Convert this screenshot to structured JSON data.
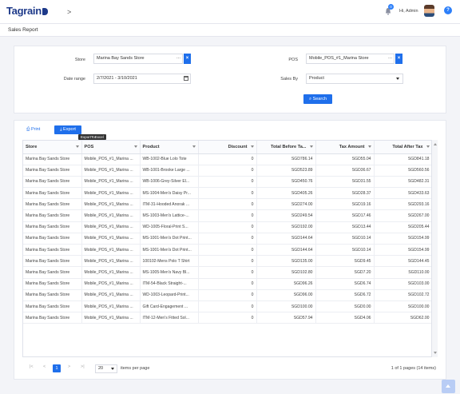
{
  "app": {
    "logo": "Tagrain",
    "greeting": "Hi, Admin",
    "notification_count": "0",
    "help": "?"
  },
  "page": {
    "title": "Sales Report"
  },
  "filters": {
    "store_label": "Store",
    "store_value": "Marina Bay Sands Store",
    "pos_label": "POS",
    "pos_value": "Mobile_POS_#1_Marina Store",
    "date_label": "Date range",
    "date_value": "2/7/2021 - 3/10/2021",
    "salesby_label": "Sales By",
    "salesby_value": "Product",
    "search_label": "Search",
    "dots": "..."
  },
  "toolbar": {
    "print_label": "Print",
    "export_label": "Export",
    "tooltip": "ExportToExcel"
  },
  "table": {
    "columns": [
      "Store",
      "POS",
      "Product",
      "Discount",
      "Total Before Ta...",
      "Tax Amount",
      "Total After Tax"
    ],
    "rows": [
      [
        "Marina Bay Sands Store",
        "Mobile_POS_#1_Marina ...",
        "WB-1002-Blue Lolo Tote",
        "0",
        "SGD786.14",
        "SGD55.04",
        "SGD841.18"
      ],
      [
        "Marina Bay Sands Store",
        "Mobile_POS_#1_Marina ...",
        "WB-1001-Brooke Large ...",
        "0",
        "SGD523.89",
        "SGD36.67",
        "SGD560.56"
      ],
      [
        "Marina Bay Sands Store",
        "Mobile_POS_#1_Marina ...",
        "WB-1006-Grey-Silver El...",
        "0",
        "SGD450.76",
        "SGD31.55",
        "SGD482.31"
      ],
      [
        "Marina Bay Sands Store",
        "Mobile_POS_#1_Marina ...",
        "MS-1004-Men's Daisy Pr...",
        "0",
        "SGD405.26",
        "SGD28.37",
        "SGD433.63"
      ],
      [
        "Marina Bay Sands Store",
        "Mobile_POS_#1_Marina ...",
        "ITM-31-Hooded Anorak ...",
        "0",
        "SGD274.00",
        "SGD19.16",
        "SGD293.16"
      ],
      [
        "Marina Bay Sands Store",
        "Mobile_POS_#1_Marina ...",
        "MS-1003-Men's Lattice-...",
        "0",
        "SGD249.54",
        "SGD17.46",
        "SGD267.00"
      ],
      [
        "Marina Bay Sands Store",
        "Mobile_POS_#1_Marina ...",
        "WD-1005-Floral-Print S...",
        "0",
        "SGD192.00",
        "SGD13.44",
        "SGD205.44"
      ],
      [
        "Marina Bay Sands Store",
        "Mobile_POS_#1_Marina ...",
        "MS-1001-Men's Dot Print...",
        "0",
        "SGD144.64",
        "SGD10.14",
        "SGD154.99"
      ],
      [
        "Marina Bay Sands Store",
        "Mobile_POS_#1_Marina ...",
        "MS-1001-Men's Dot Print...",
        "0",
        "SGD144.64",
        "SGD10.14",
        "SGD154.99"
      ],
      [
        "Marina Bay Sands Store",
        "Mobile_POS_#1_Marina ...",
        "100102-Mens Polo T Shirt",
        "0",
        "SGD135.00",
        "SGD9.45",
        "SGD144.45"
      ],
      [
        "Marina Bay Sands Store",
        "Mobile_POS_#1_Marina ...",
        "MS-1005-Men's Navy Bl...",
        "0",
        "SGD102.80",
        "SGD7.20",
        "SGD110.00"
      ],
      [
        "Marina Bay Sands Store",
        "Mobile_POS_#1_Marina ...",
        "ITM-54-Black Straight-...",
        "0",
        "SGD96.26",
        "SGD6.74",
        "SGD103.00"
      ],
      [
        "Marina Bay Sands Store",
        "Mobile_POS_#1_Marina ...",
        "WD-1003-Leopard-Print...",
        "0",
        "SGD96.00",
        "SGD6.72",
        "SGD102.72"
      ],
      [
        "Marina Bay Sands Store",
        "Mobile_POS_#1_Marina ...",
        "Gift Card-Engagement ...",
        "0",
        "SGD100.00",
        "SGD0.00",
        "SGD100.00"
      ],
      [
        "Marina Bay Sands Store",
        "Mobile_POS_#1_Marina ...",
        "ITM-12-Men's Fitted Sol...",
        "0",
        "SGD57.94",
        "SGD4.06",
        "SGD62.00"
      ]
    ]
  },
  "pager": {
    "first": "|<",
    "prev": "<",
    "current": "1",
    "next": ">",
    "last": ">|",
    "page_size": "20",
    "items_per_page": "items per page",
    "info": "1 of 1 pages (14 items)"
  },
  "colors": {
    "primary": "#1f6feb",
    "brand": "#1e3a8a"
  }
}
